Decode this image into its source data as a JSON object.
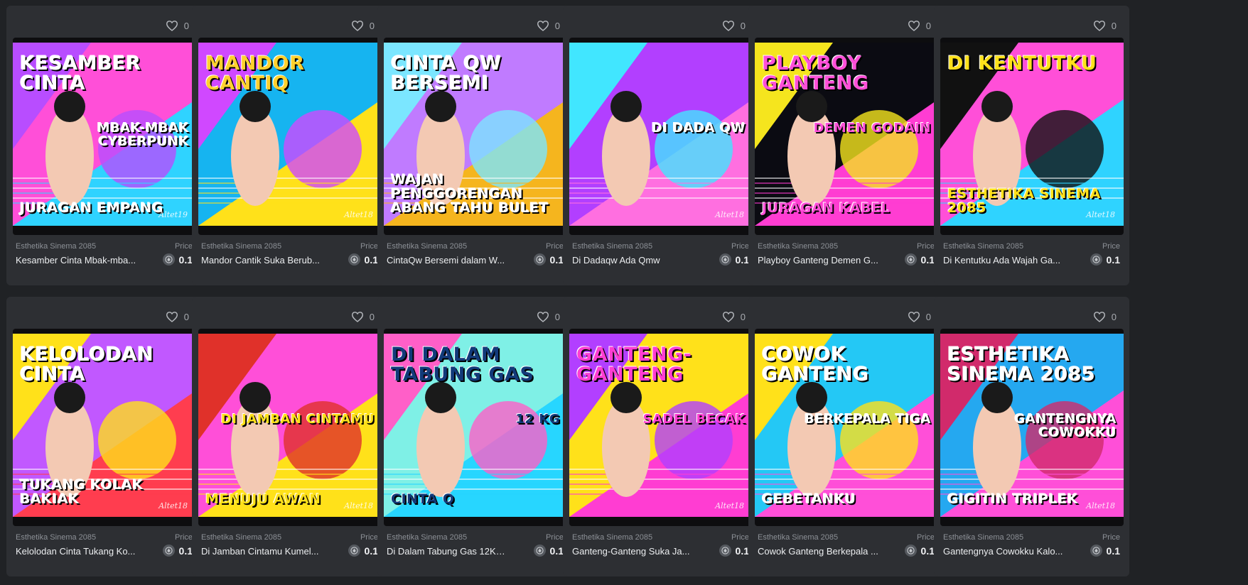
{
  "price_label": "Price",
  "currency_icon": "flow-coin-icon",
  "cards": [
    {
      "collection": "Esthetika Sinema 2085",
      "name": "Kesamber Cinta Mbak-mba...",
      "price": "0.1",
      "likes": "0",
      "art": {
        "top": "Kesamber Cinta",
        "mid": "Mbak-Mbak Cyberpunk",
        "bot": "Juragan Empang",
        "sig": "Altet19",
        "bg": "#ff4fd8",
        "accent": "#2fd3ff",
        "shape": "#b84dff",
        "text": "#ffffff"
      }
    },
    {
      "collection": "Esthetika Sinema 2085",
      "name": "Mandor Cantik Suka Berub...",
      "price": "0.1",
      "likes": "0",
      "art": {
        "top": "Mandor Cantiq",
        "mid": "",
        "bot": "",
        "sig": "Altet18",
        "bg": "#16b4f0",
        "accent": "#ffe11a",
        "shape": "#d048ff",
        "text": "#ffd12e"
      }
    },
    {
      "collection": "Esthetika Sinema 2085",
      "name": "CintaQw Bersemi dalam W...",
      "price": "0.1",
      "likes": "0",
      "art": {
        "top": "Cinta Qw Bersemi",
        "mid": "",
        "bot": "Wajan Penggorengan Abang Tahu Bulet",
        "sig": "",
        "bg": "#c07bff",
        "accent": "#f5b51e",
        "shape": "#7be6ff",
        "text": "#ffffff"
      }
    },
    {
      "collection": "Esthetika Sinema 2085",
      "name": "Di Dadaqw Ada Qmw",
      "price": "0.1",
      "likes": "0",
      "art": {
        "top": "",
        "mid": "Di Dada Qw",
        "bot": "",
        "sig": "Altet18",
        "bg": "#b23fff",
        "accent": "#ff6fe0",
        "shape": "#41e6ff",
        "text": "#ffffff"
      }
    },
    {
      "collection": "Esthetika Sinema 2085",
      "name": "Playboy Ganteng Demen G...",
      "price": "0.1",
      "likes": "0",
      "art": {
        "top": "Playboy Ganteng",
        "mid": "Demen Godain",
        "bot": "Juragan Kabel",
        "sig": "",
        "bg": "#0b0b12",
        "accent": "#ff3dd2",
        "shape": "#f5e51e",
        "text": "#ff4fd8"
      }
    },
    {
      "collection": "Esthetika Sinema 2085",
      "name": "Di Kentutku Ada Wajah Ga...",
      "price": "0.1",
      "likes": "0",
      "art": {
        "top": "Di Kentutku",
        "mid": "",
        "bot": "Esthetika Sinema 2085",
        "sig": "Altet18",
        "bg": "#ff4fd8",
        "accent": "#2fd3ff",
        "shape": "#111111",
        "text": "#ffe11a"
      }
    },
    {
      "collection": "Esthetika Sinema 2085",
      "name": "Kelolodan Cinta Tukang Ko...",
      "price": "0.1",
      "likes": "0",
      "art": {
        "top": "Kelolodan Cinta",
        "mid": "",
        "bot": "Tukang Kolak Bakiak",
        "sig": "Altet18",
        "bg": "#c158ff",
        "accent": "#ff3d4f",
        "shape": "#ffe11a",
        "text": "#ffffff"
      }
    },
    {
      "collection": "Esthetika Sinema 2085",
      "name": "Di Jamban Cintamu Kumel...",
      "price": "0.1",
      "likes": "0",
      "art": {
        "top": "",
        "mid": "Di Jamban Cintamu",
        "bot": "Menuju Awan",
        "sig": "Altet18",
        "bg": "#ff4fd8",
        "accent": "#ffe11a",
        "shape": "#e0312a",
        "text": "#ffe11a"
      }
    },
    {
      "collection": "Esthetika Sinema 2085",
      "name": "Di Dalam Tabung Gas 12Kg...",
      "price": "0.1",
      "likes": "0",
      "art": {
        "top": "Di Dalam Tabung Gas",
        "mid": "12 Kg",
        "bot": "Cinta Q",
        "sig": "",
        "bg": "#7ff0e6",
        "accent": "#27d6ff",
        "shape": "#ff5fc8",
        "text": "#123a7a"
      }
    },
    {
      "collection": "Esthetika Sinema 2085",
      "name": "Ganteng-Ganteng Suka Ja...",
      "price": "0.1",
      "likes": "0",
      "art": {
        "top": "Ganteng-Ganteng",
        "mid": "Sadel Becak",
        "bot": "",
        "sig": "Altet18",
        "bg": "#ffe11a",
        "accent": "#ff3dd2",
        "shape": "#b23fff",
        "text": "#ff3dd2"
      }
    },
    {
      "collection": "Esthetika Sinema 2085",
      "name": "Cowok Ganteng Berkepala ...",
      "price": "0.1",
      "likes": "0",
      "art": {
        "top": "Cowok Ganteng",
        "mid": "Berkepala Tiga",
        "bot": "Gebetanku",
        "sig": "",
        "bg": "#24c8f5",
        "accent": "#ff4fd8",
        "shape": "#ffe11a",
        "text": "#ffffff"
      }
    },
    {
      "collection": "Esthetika Sinema 2085",
      "name": "Gantengnya Cowokku Kalo...",
      "price": "0.1",
      "likes": "0",
      "art": {
        "top": "Esthetika Sinema 2085",
        "mid": "Gantengnya Cowokku",
        "bot": "Gigitin Triplek",
        "sig": "Altet18",
        "bg": "#25a8f0",
        "accent": "#ff4fd8",
        "shape": "#d12a6b",
        "text": "#ffffff"
      }
    }
  ]
}
